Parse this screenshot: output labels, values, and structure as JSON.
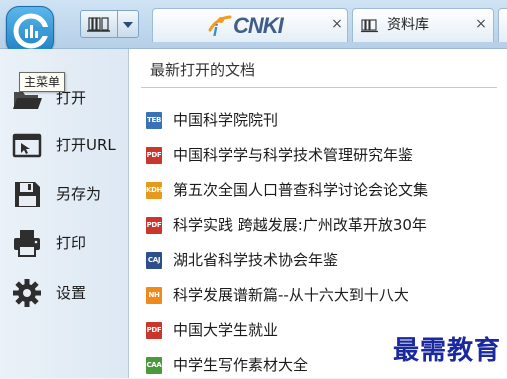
{
  "toolbar": {
    "app_logo_icon": "cajviewer-logo-icon",
    "book_dropdown_icon": "bookshelf-icon",
    "arrow_icon": "chevron-down-icon"
  },
  "tabs": [
    {
      "label": "CNKI",
      "logo_prefix": "i",
      "close": "×"
    },
    {
      "label": "资料库",
      "icon": "bookshelf-icon",
      "close": "×"
    }
  ],
  "tooltip": "主菜单",
  "menu": [
    {
      "label": "打开",
      "icon": "open-folder-icon"
    },
    {
      "label": "打开URL",
      "icon": "open-url-icon"
    },
    {
      "label": "另存为",
      "icon": "save-disk-icon"
    },
    {
      "label": "打印",
      "icon": "printer-icon"
    },
    {
      "label": "设置",
      "icon": "gear-icon"
    }
  ],
  "recent": {
    "title": "最新打开的文档",
    "items": [
      {
        "type": "TEB",
        "color": "#3a72b8",
        "name": "中国科学院院刊"
      },
      {
        "type": "PDF",
        "color": "#c8362c",
        "name": "中国科学学与科学技术管理研究年鉴"
      },
      {
        "type": "KDH",
        "color": "#e59a1e",
        "name": "第五次全国人口普查科学讨论会论文集"
      },
      {
        "type": "PDF",
        "color": "#c8362c",
        "name": "科学实践 跨越发展:广州改革开放30年"
      },
      {
        "type": "CAJ",
        "color": "#2d4f8c",
        "name": "湖北省科学技术协会年鉴"
      },
      {
        "type": "NH",
        "color": "#ef8a1c",
        "name": "科学发展谱新篇--从十六大到十八大"
      },
      {
        "type": "PDF",
        "color": "#c8362c",
        "name": "中国大学生就业"
      },
      {
        "type": "CAA",
        "color": "#4a9a3c",
        "name": "中学生写作素材大全"
      }
    ]
  },
  "watermark": "最需教育"
}
